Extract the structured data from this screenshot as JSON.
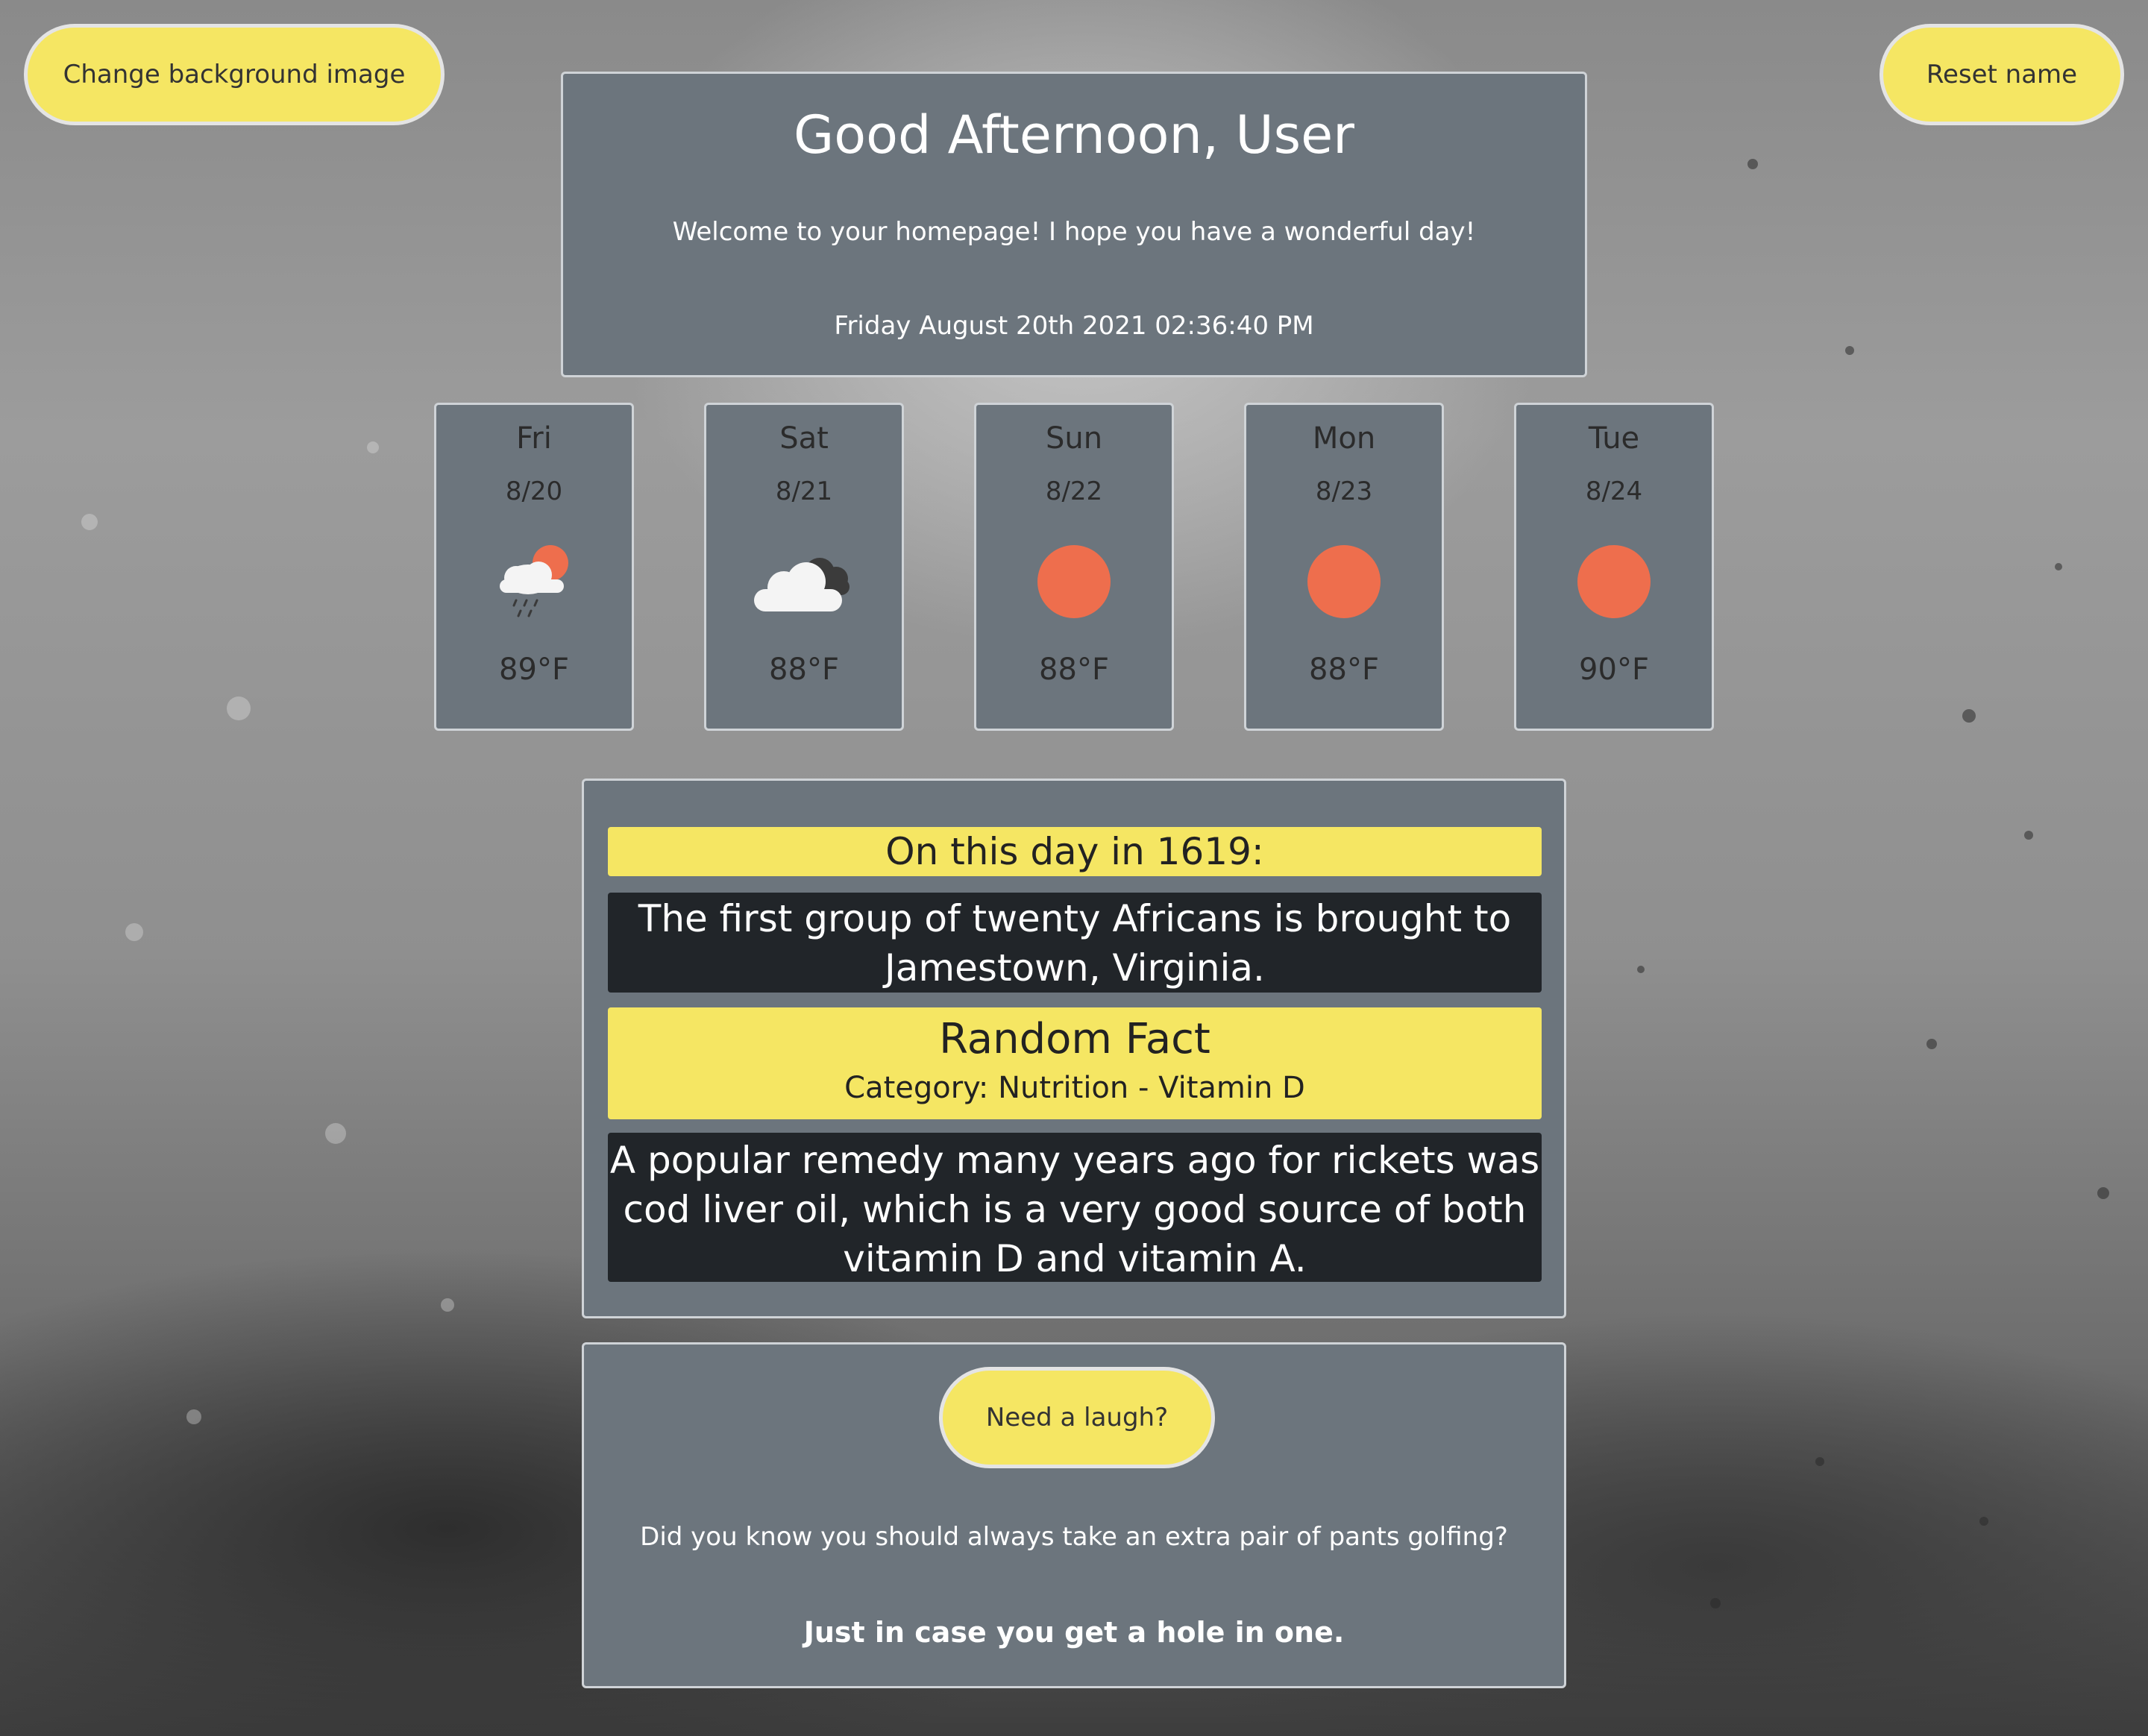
{
  "buttons": {
    "change_background": "Change background image",
    "reset_name": "Reset name",
    "need_laugh": "Need a laugh?"
  },
  "greeting": {
    "title": "Good Afternoon, User",
    "welcome": "Welcome to your homepage! I hope you have a wonderful day!",
    "datetime": "Friday August 20th 2021 02:36:40 PM"
  },
  "forecast": [
    {
      "day": "Fri",
      "date": "8/20",
      "icon": "rain-sun-icon",
      "temp": "89°F"
    },
    {
      "day": "Sat",
      "date": "8/21",
      "icon": "cloudy-icon",
      "temp": "88°F"
    },
    {
      "day": "Sun",
      "date": "8/22",
      "icon": "sun-icon",
      "temp": "88°F"
    },
    {
      "day": "Mon",
      "date": "8/23",
      "icon": "sun-icon",
      "temp": "88°F"
    },
    {
      "day": "Tue",
      "date": "8/24",
      "icon": "sun-icon",
      "temp": "90°F"
    }
  ],
  "on_this_day": {
    "heading": "On this day in 1619:",
    "text": "The first group of twenty Africans is brought to Jamestown, Virginia."
  },
  "random_fact": {
    "title": "Random Fact",
    "category": "Category: Nutrition - Vitamin D",
    "text": "A popular remedy many years ago for rickets was cod liver oil, which is a very good source of both vitamin D and vitamin A."
  },
  "joke": {
    "setup": "Did you know you should always take an extra pair of pants golfing?",
    "punchline": "Just in case you get a hole in one."
  },
  "colors": {
    "accent_yellow": "#f5e663",
    "panel_gray": "#6c757d",
    "dark_bar": "#212529",
    "sun_orange": "#ee6e4d"
  }
}
